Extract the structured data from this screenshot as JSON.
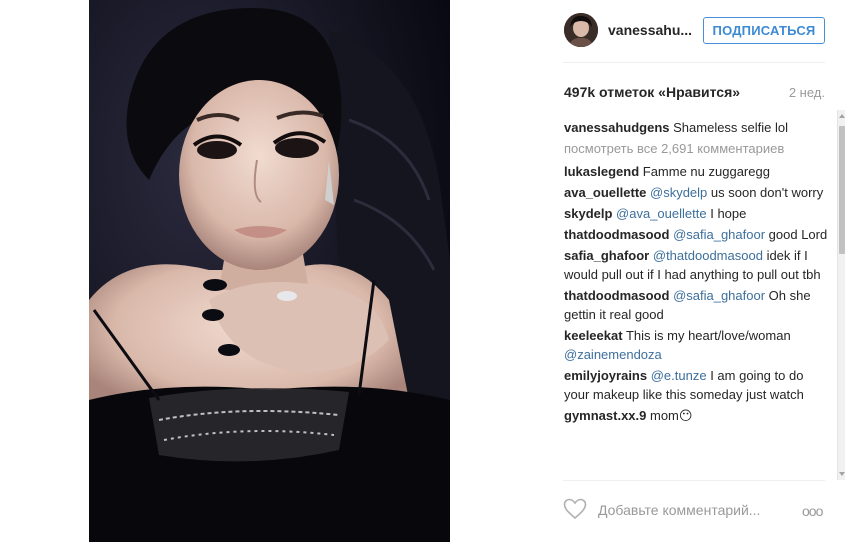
{
  "post": {
    "username": "vanessahu...",
    "follow_label": "ПОДПИСАТЬСЯ",
    "likes": "497k отметок «Нравится»",
    "time": "2 нед."
  },
  "comments": {
    "view_all": "посмотреть все 2,691 комментариев",
    "items": [
      {
        "user": "vanessahudgens",
        "text": "Shameless selfie lol"
      },
      {
        "user": "lukaslegend",
        "text": "Famme nu zuggaregg"
      },
      {
        "user": "ava_ouellette",
        "mention": "@skydelp",
        "text": "us soon don't worry"
      },
      {
        "user": "skydelp",
        "mention": "@ava_ouellette",
        "text": "I hope"
      },
      {
        "user": "thatdoodmasood",
        "mention": "@safia_ghafoor",
        "text": "good Lord"
      },
      {
        "user": "safia_ghafoor",
        "mention": "@thatdoodmasood",
        "text": "idek if I would pull out if I had anything to pull out tbh"
      },
      {
        "user": "thatdoodmasood",
        "mention": "@safia_ghafoor",
        "text": "Oh she gettin it real good"
      },
      {
        "user": "keeleekat",
        "text": "This is my heart/love/woman",
        "mention_after": "@zainemendoza"
      },
      {
        "user": "emilyjoyrains",
        "mention": "@e.tunze",
        "text": "I am going to do your makeup like this someday just watch"
      },
      {
        "user": "gymnast.xx.9",
        "text": "mom😶"
      }
    ]
  },
  "footer": {
    "add_comment_placeholder": "Добавьте комментарий...",
    "more_label": "ooo"
  },
  "icons": {
    "like": "heart-outline-icon",
    "more": "more-dots-icon"
  },
  "colors": {
    "follow_blue": "#3d8ad4",
    "mention_blue": "#3d6f9c",
    "muted_gray": "#999999"
  }
}
